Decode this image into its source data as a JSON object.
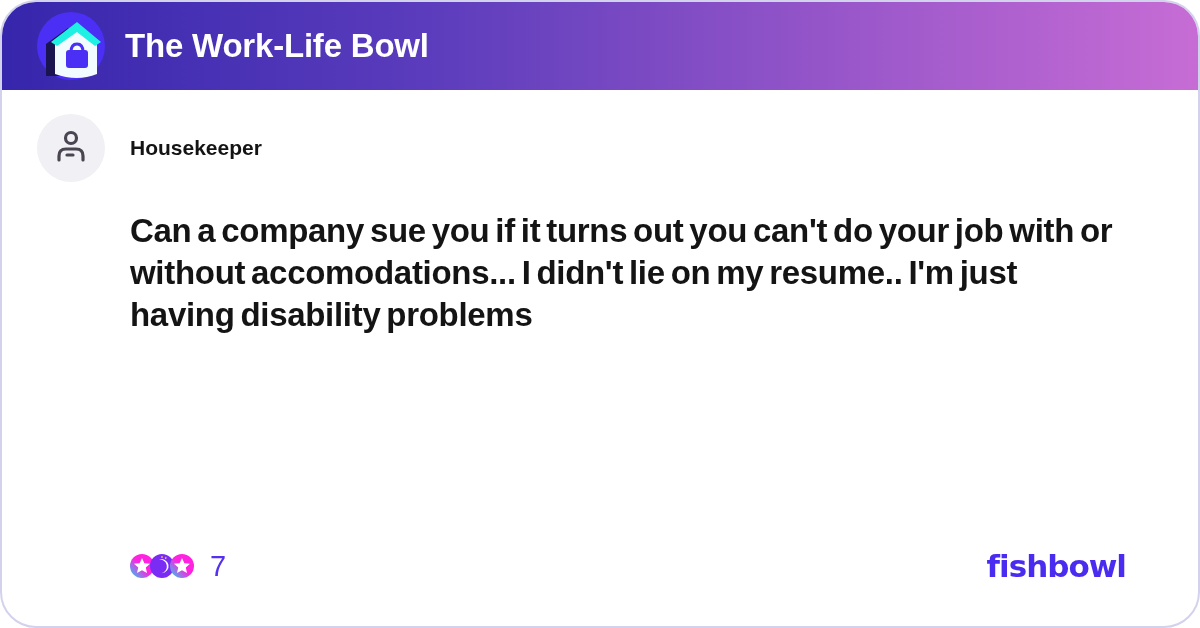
{
  "header": {
    "title": "The Work-Life Bowl"
  },
  "post": {
    "author": "Housekeeper",
    "question": "Can a company sue you if it turns out you can't do your job with or without accomodations... I didn't lie on my resume.. I'm just having disability problems"
  },
  "footer": {
    "reaction_count": "7",
    "brand": "fishbowl"
  }
}
